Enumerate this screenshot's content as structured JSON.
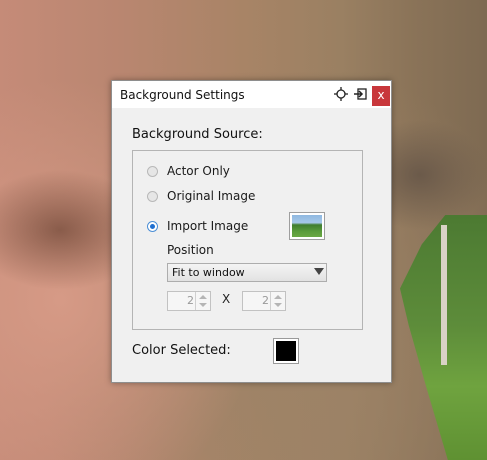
{
  "window": {
    "title": "Background Settings",
    "close_label": "x"
  },
  "background_source": {
    "label": "Background Source:",
    "options": [
      {
        "label": "Actor Only",
        "selected": false
      },
      {
        "label": "Original Image",
        "selected": false
      },
      {
        "label": "Import Image",
        "selected": true
      }
    ]
  },
  "position": {
    "label": "Position",
    "selected": "Fit to window"
  },
  "tiling": {
    "columns": "2",
    "separator": "X",
    "rows": "2"
  },
  "color": {
    "label": "Color Selected:",
    "value": "#000000"
  },
  "icons": {
    "pin": "crosshair-pin-icon",
    "dock": "dock-window-icon",
    "close": "close-icon",
    "dropdown": "chevron-down-icon"
  },
  "colors": {
    "close_button": "#c8373b",
    "radio_selected": "#1f6fd0"
  }
}
